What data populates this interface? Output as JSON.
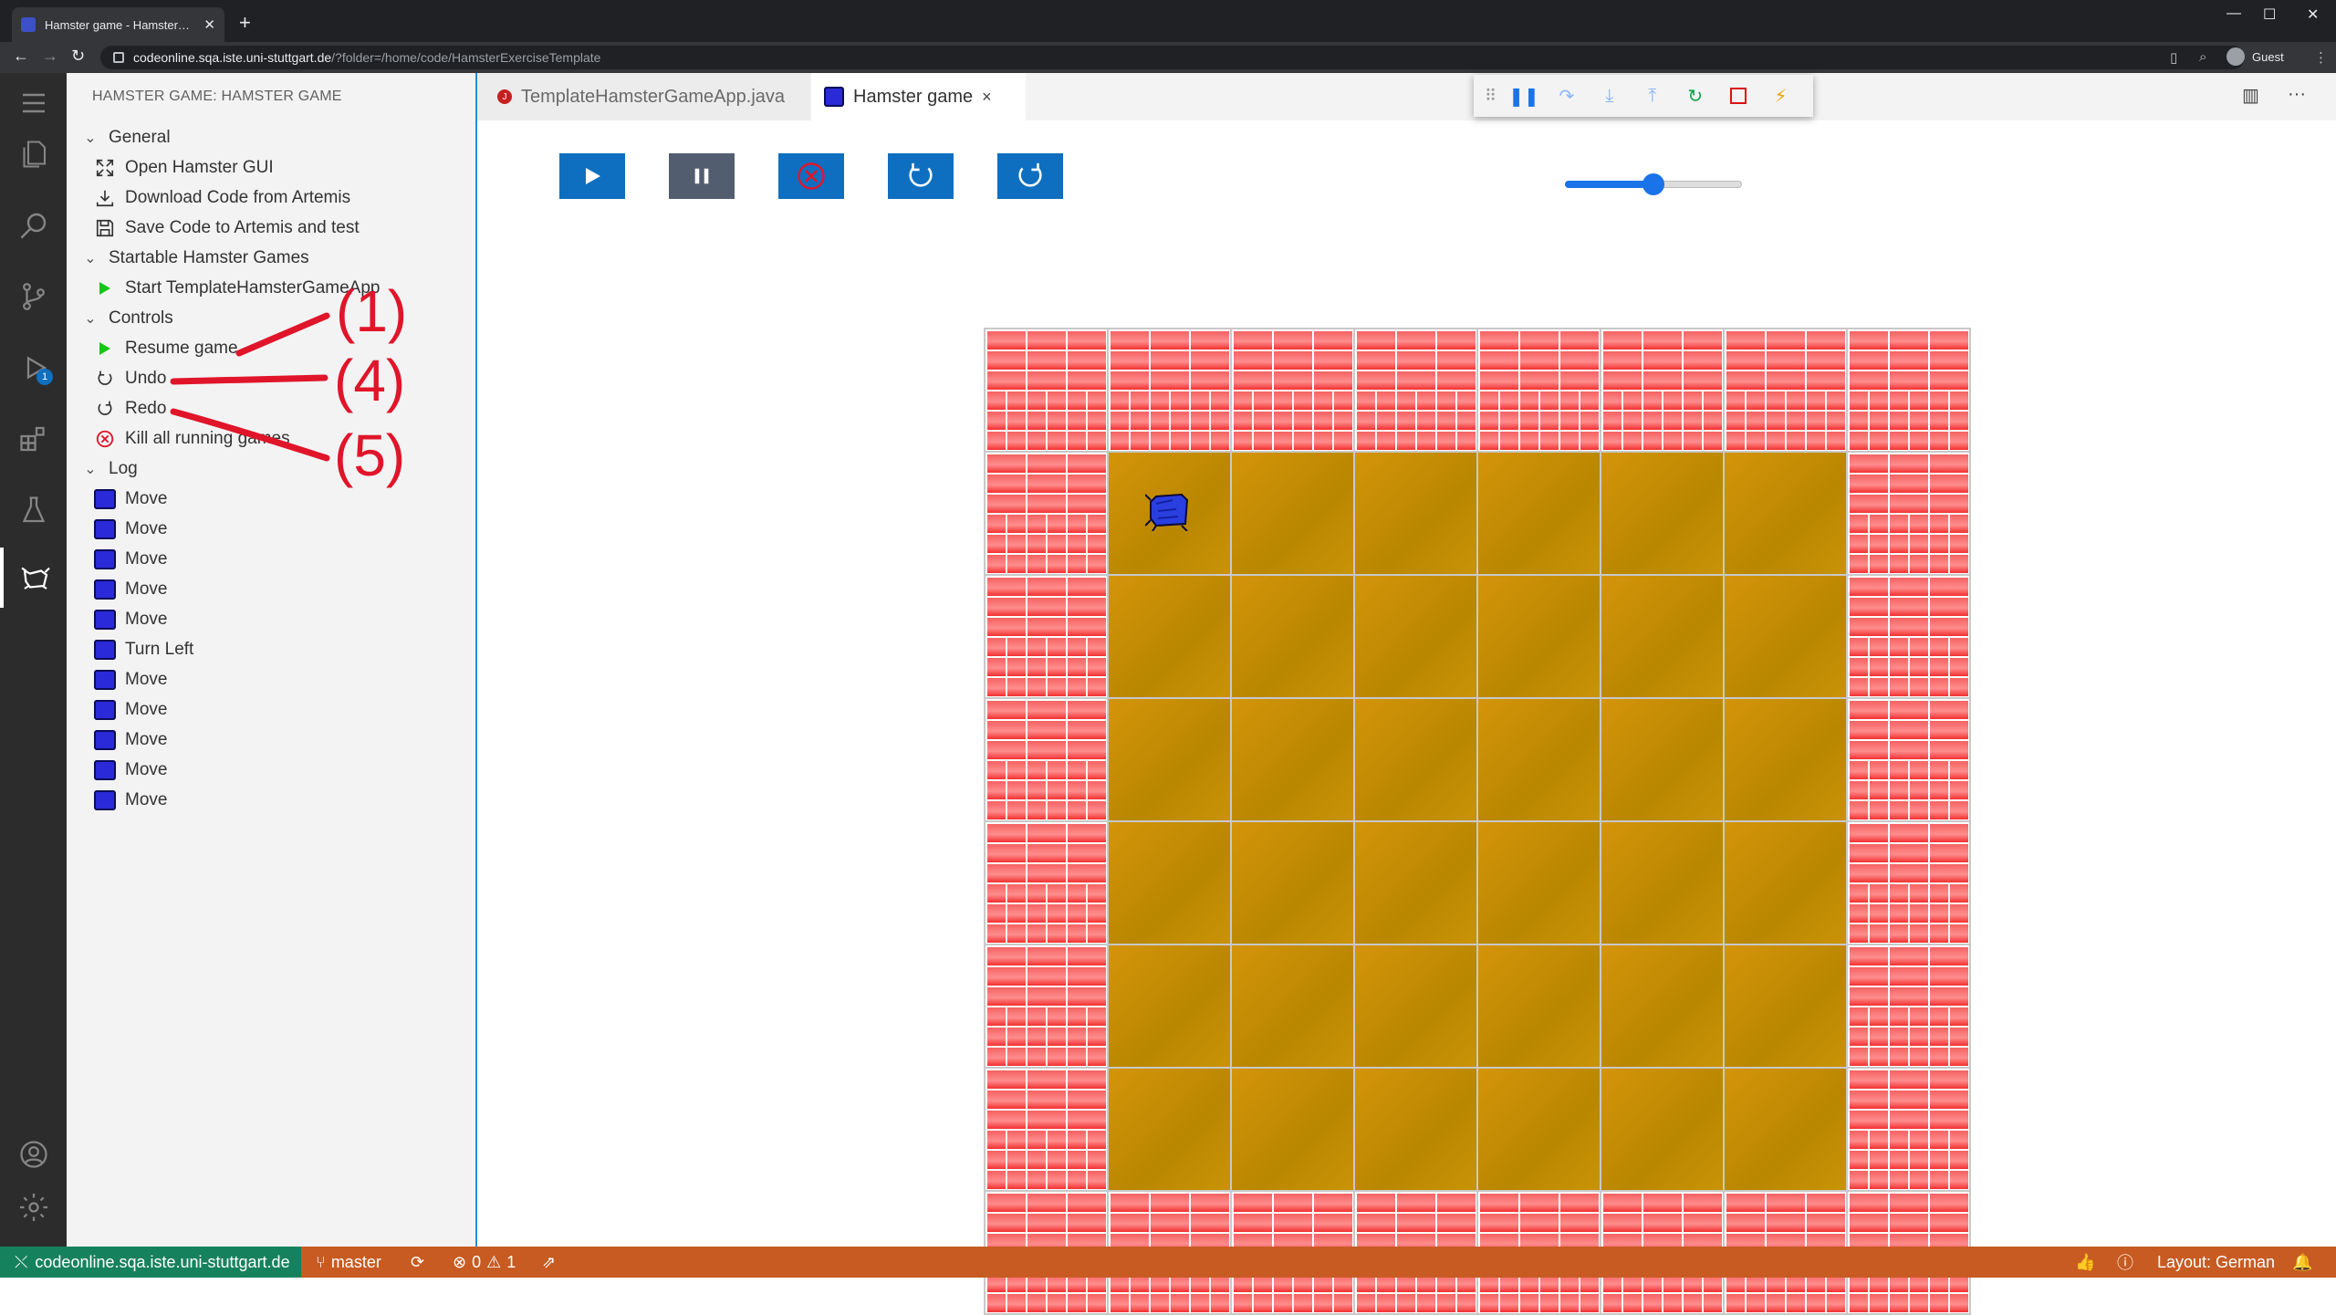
{
  "browser": {
    "tab_title": "Hamster game - HamsterExercise",
    "tab_close": "✕",
    "new_tab": "+",
    "win_min": "—",
    "win_max": "☐",
    "win_close": "✕",
    "url_host": "codeonline.sqa.iste.uni-stuttgart.de",
    "url_path": "/?folder=/home/code/HamsterExerciseTemplate",
    "profile": "Guest"
  },
  "sidebar": {
    "title": "HAMSTER GAME: HAMSTER GAME",
    "sections": {
      "general": "General",
      "startable": "Startable Hamster Games",
      "controls": "Controls",
      "log": "Log"
    },
    "general_items": [
      "Open Hamster GUI",
      "Download Code from Artemis",
      "Save Code to Artemis and test"
    ],
    "startable_items": [
      "Start TemplateHamsterGameApp"
    ],
    "controls_items": [
      "Resume game",
      "Undo",
      "Redo",
      "Kill all running games"
    ],
    "log_items": [
      "Move",
      "Move",
      "Move",
      "Move",
      "Move",
      "Turn Left",
      "Move",
      "Move",
      "Move",
      "Move",
      "Move"
    ]
  },
  "activity_badge": "1",
  "editor": {
    "tabs": [
      {
        "label": "TemplateHamsterGameApp.java"
      },
      {
        "label": "Hamster game"
      }
    ],
    "tab_close": "×",
    "more": "···"
  },
  "game": {
    "speed_fraction": 0.5,
    "rows": 8,
    "cols": 8,
    "hamster_row": 1,
    "hamster_col": 1,
    "hamster_direction": "west"
  },
  "annotations": [
    "(1)",
    "(4)",
    "(5)"
  ],
  "statusbar": {
    "remote": "codeonline.sqa.iste.uni-stuttgart.de",
    "branch": "master",
    "errors": "0",
    "warnings": "1",
    "layout": "Layout: German"
  },
  "colors": {
    "accent": "#0e6fc0",
    "status_bar": "#c75b22",
    "remote": "#16825d",
    "annotation": "#e0152a"
  }
}
